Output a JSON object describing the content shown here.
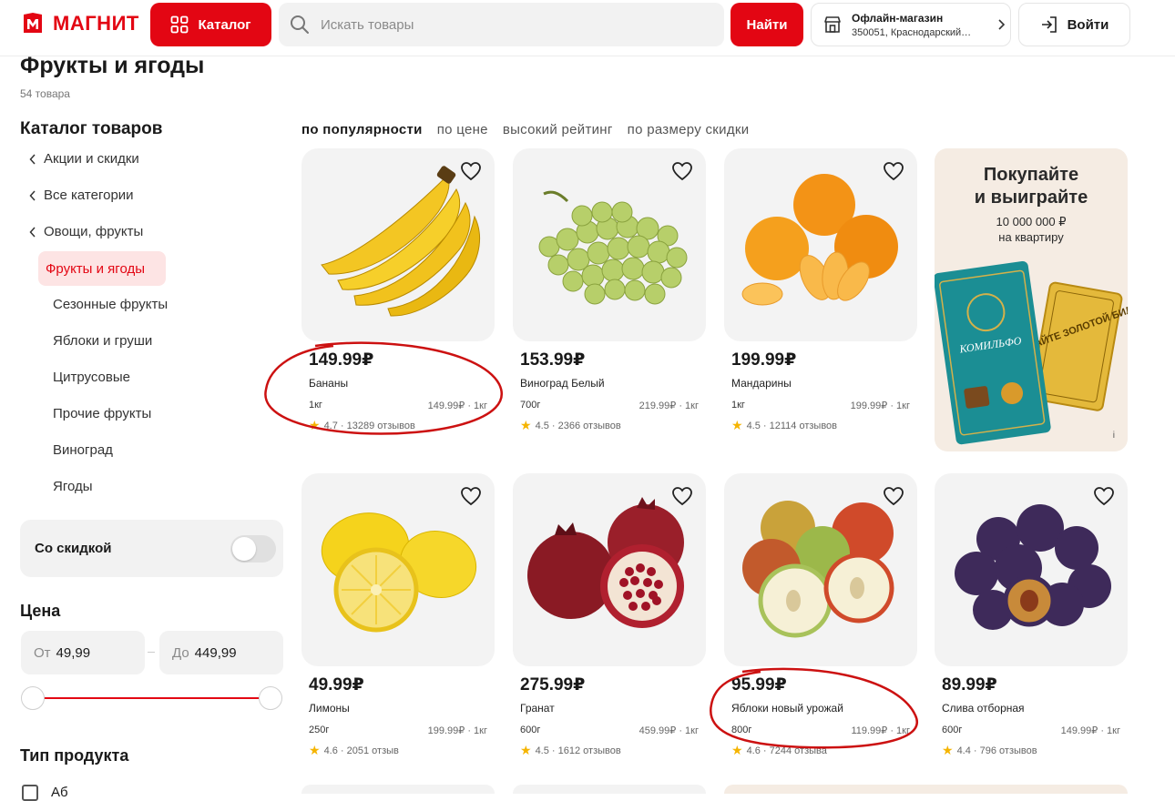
{
  "header": {
    "logo_text": "МАГНИТ",
    "catalog_label": "Каталог",
    "search_placeholder": "Искать товары",
    "find_label": "Найти",
    "store_title": "Офлайн-магазин",
    "store_address": "350051, Краснодарский…",
    "login_label": "Войти"
  },
  "page": {
    "title": "Фрукты и ягоды",
    "count": "54 товара"
  },
  "sidebar": {
    "title": "Каталог товаров",
    "back_items": [
      "Акции и скидки",
      "Все категории",
      "Овощи, фрукты"
    ],
    "active": "Фрукты и ягоды",
    "sub_items": [
      "Сезонные фрукты",
      "Яблоки и груши",
      "Цитрусовые",
      "Прочие фрукты",
      "Виноград",
      "Ягоды"
    ],
    "discount_label": "Со скидкой",
    "discount_on": false,
    "price_title": "Цена",
    "price_from_label": "От",
    "price_from": "49,99",
    "price_to_label": "До",
    "price_to": "449,99",
    "type_title": "Тип продукта",
    "type_first": "Аб"
  },
  "sort": {
    "options": [
      "по популярности",
      "по цене",
      "высокий рейтинг",
      "по размеру скидки"
    ],
    "selected": "по популярности"
  },
  "products": [
    {
      "price": "149.99₽",
      "name": "Бананы",
      "weight": "1кг",
      "unit_price": "149.99₽ · 1кг",
      "rating": "4.7 · 13289 отзывов",
      "image": "banana"
    },
    {
      "price": "153.99₽",
      "name": "Виноград Белый",
      "weight": "700г",
      "unit_price": "219.99₽ · 1кг",
      "rating": "4.5 · 2366 отзывов",
      "image": "grapes"
    },
    {
      "price": "199.99₽",
      "name": "Мандарины",
      "weight": "1кг",
      "unit_price": "199.99₽ · 1кг",
      "rating": "4.5 · 12114 отзывов",
      "image": "tangerine"
    },
    {
      "price": "49.99₽",
      "name": "Лимоны",
      "weight": "250г",
      "unit_price": "199.99₽ · 1кг",
      "rating": "4.6 · 2051 отзыв",
      "image": "lemon"
    },
    {
      "price": "275.99₽",
      "name": "Гранат",
      "weight": "600г",
      "unit_price": "459.99₽ · 1кг",
      "rating": "4.5 · 1612 отзывов",
      "image": "pomegranate"
    },
    {
      "price": "95.99₽",
      "name": "Яблоки новый урожай",
      "weight": "800г",
      "unit_price": "119.99₽ · 1кг",
      "rating": "4.6 · 7244 отзыва",
      "image": "apples"
    },
    {
      "price": "89.99₽",
      "name": "Слива отборная",
      "weight": "600г",
      "unit_price": "149.99₽ · 1кг",
      "rating": "4.4 · 796 отзывов",
      "image": "plums"
    }
  ],
  "promo": {
    "headline_1": "Покупайте",
    "headline_2": "и выиграйте",
    "sub_1": "10 000 000 ₽",
    "sub_2": "на квартиру",
    "brand": "КОМИЛЬФО",
    "ticket": "ВЫИГРАЙТЕ ЗОЛОТОЙ БИЛЕТ",
    "info": "i"
  },
  "colors": {
    "brand_red": "#e30613",
    "annotation_red": "#cc1111",
    "star": "#f5b400"
  }
}
